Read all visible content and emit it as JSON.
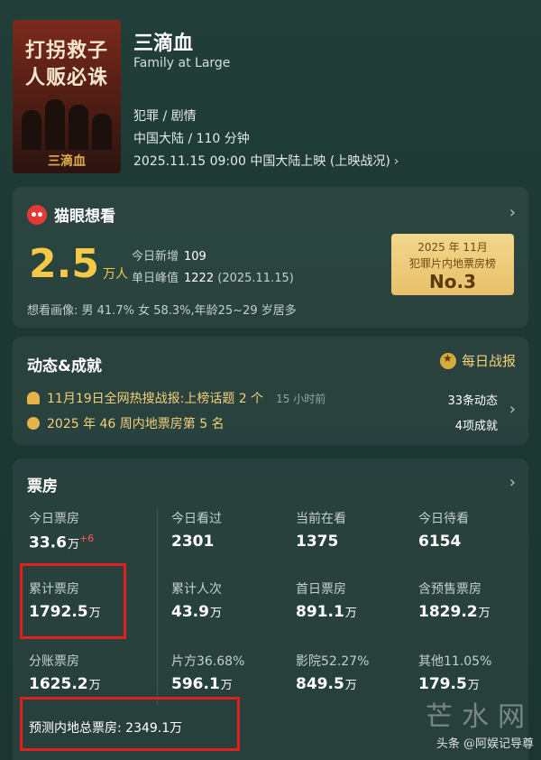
{
  "movie": {
    "poster_line1": "打拐救子",
    "poster_line2": "人贩必诛",
    "poster_title": "三滴血",
    "title": "三滴血",
    "subtitle": "Family at Large",
    "genre": "犯罪 / 剧情",
    "region_runtime": "中国大陆 / 110 分钟",
    "release": "2025.11.15 09:00 中国大陆上映 (上映战况)",
    "chevron": "›"
  },
  "want": {
    "header": "猫眼想看",
    "value": "2.5",
    "unit": "万人",
    "today_label": "今日新增",
    "today_value": "109",
    "peak_label": "单日峰值",
    "peak_value": "1222",
    "peak_date": "(2025.11.15)",
    "rank_line1": "2025 年 11月",
    "rank_line2": "犯罪片内地票房榜",
    "rank_no": "No.3",
    "portrait": "想看画像: 男 41.7%  女 58.3%,年龄25~29 岁居多"
  },
  "news": {
    "header": "动态&成就",
    "daily_btn": "每日战报",
    "item1": "11月19日全网热搜战报:上榜话题 2 个",
    "item1_time": "15 小时前",
    "item2": "2025 年 46 周内地票房第 5 名",
    "count1": "33条动态",
    "count2": "4项成就"
  },
  "boxoffice": {
    "header": "票房",
    "cells": [
      {
        "label": "今日票房",
        "value": "33.6",
        "unit": "万",
        "delta": "+6"
      },
      {
        "label": "今日看过",
        "value": "2301",
        "unit": ""
      },
      {
        "label": "当前在看",
        "value": "1375",
        "unit": ""
      },
      {
        "label": "今日待看",
        "value": "6154",
        "unit": ""
      },
      {
        "label": "累计票房",
        "value": "1792.5",
        "unit": "万"
      },
      {
        "label": "累计人次",
        "value": "43.9",
        "unit": "万"
      },
      {
        "label": "首日票房",
        "value": "891.1",
        "unit": "万"
      },
      {
        "label": "含预售票房",
        "value": "1829.2",
        "unit": "万"
      },
      {
        "label": "分账票房",
        "value": "1625.2",
        "unit": "万"
      },
      {
        "label": "片方36.68%",
        "value": "596.1",
        "unit": "万"
      },
      {
        "label": "影院52.27%",
        "value": "849.5",
        "unit": "万"
      },
      {
        "label": "其他11.05%",
        "value": "179.5",
        "unit": "万"
      }
    ],
    "forecast": "预测内地总票房: 2349.1万"
  },
  "watermark": {
    "big": "芒水网",
    "small": "头条 @阿娱记导尊"
  },
  "colors": {
    "background": "#1f3a35",
    "accent_gold": "#f5c945",
    "highlight_red": "#e01f1f"
  }
}
